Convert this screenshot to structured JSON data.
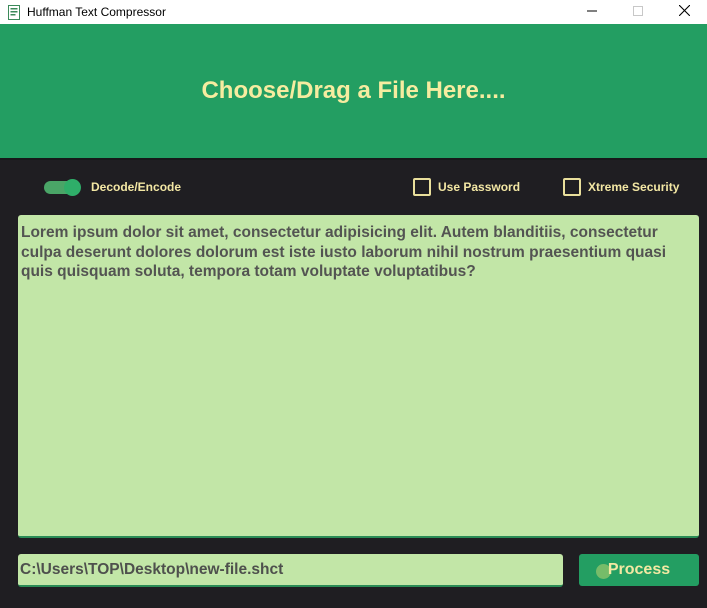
{
  "window": {
    "title": "Huffman Text Compressor",
    "minimize_icon": "minimize-icon",
    "maximize_icon": "maximize-icon",
    "close_icon": "close-icon"
  },
  "dropzone": {
    "label": "Choose/Drag a File Here...."
  },
  "options": {
    "toggle_label": "Decode/Encode",
    "toggle_on": true,
    "use_password_label": "Use Password",
    "use_password_checked": false,
    "xtreme_security_label": "Xtreme Security",
    "xtreme_security_checked": false
  },
  "editor": {
    "text": "Lorem ipsum dolor sit amet, consectetur adipisicing elit. Autem blanditiis, consectetur culpa deserunt dolores dolorum est iste iusto laborum nihil nostrum praesentium quasi quis quisquam soluta, tempora totam voluptate voluptatibus?"
  },
  "footer": {
    "path_value": "C:\\Users\\TOP\\Desktop\\new-file.shct",
    "process_label": "Process"
  },
  "colors": {
    "accent_green": "#239e62",
    "text_yellow": "#f6eca0",
    "background": "#1f1e22",
    "field_bg": "#c2e6a7"
  }
}
